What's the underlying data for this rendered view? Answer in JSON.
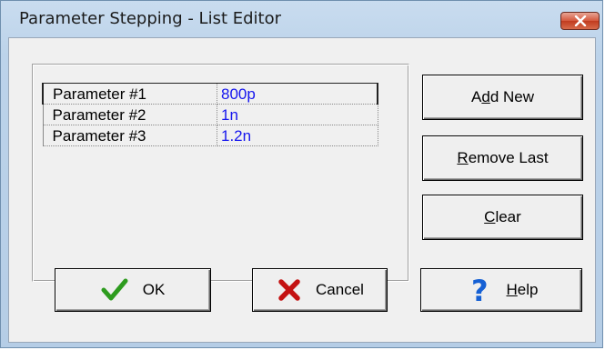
{
  "window": {
    "title": "Parameter Stepping - List Editor",
    "close_icon": "close-icon"
  },
  "parameters": [
    {
      "name": "Parameter #1",
      "value": "800p"
    },
    {
      "name": "Parameter #2",
      "value": "1n"
    },
    {
      "name": "Parameter #3",
      "value": "1.2n"
    }
  ],
  "side_buttons": {
    "add_new": {
      "pre": "A",
      "mnemonic": "d",
      "post": "d New"
    },
    "remove_last": {
      "pre": "",
      "mnemonic": "R",
      "post": "emove Last"
    },
    "clear": {
      "pre": "",
      "mnemonic": "C",
      "post": "lear"
    }
  },
  "bottom_buttons": {
    "ok": {
      "label": "OK",
      "icon": "checkmark-icon"
    },
    "cancel": {
      "label": "Cancel",
      "icon": "x-icon"
    },
    "help": {
      "pre": "",
      "mnemonic": "H",
      "post": "elp",
      "icon": "question-mark-icon"
    }
  },
  "colors": {
    "value_text": "#1515ee",
    "check_green": "#2d9b1e",
    "cancel_red": "#c41313",
    "help_blue": "#1560d4"
  }
}
